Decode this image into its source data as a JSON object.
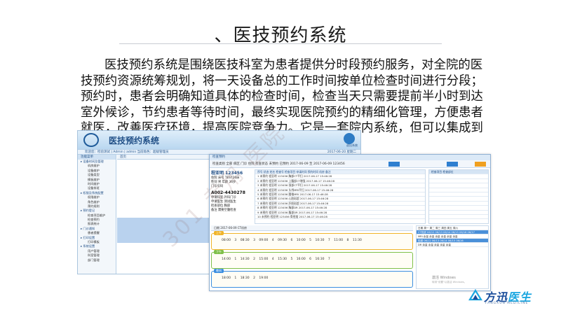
{
  "slide": {
    "title": "、医技预约系统",
    "paragraph": "医技预约系统是围绕医技科室为患者提供分时段预约服务，对全院的医技预约资源统筹规划，将一天设备总的工作时间按单位检查时间进行分段；预约时，患者会明确知道具体的检查时间，检查当天只需要提前半小时到达室外候诊，节约患者等待时间，最终实现医院预约的精细化管理，方便患者就医，改善医疗环境，提高医院竞争力。它是一套院内系统，但可以集成到互联网医院的医生工作站上。",
    "watermark": "301 专用 医院"
  },
  "app_window": {
    "title": "医技预约系统",
    "exit_label": "退出系统",
    "status_left": "欢迎您：检验测试 | Admin | admin   当前角色：超级管理员",
    "status_right": "2017-06-20 星期二",
    "side_header": "功能菜单",
    "tab_label": "首页",
    "menu": [
      {
        "label": "设备时间及管理",
        "type": "group"
      },
      {
        "label": "机房维护",
        "type": "child"
      },
      {
        "label": "设备维护",
        "type": "child"
      },
      {
        "label": "设备类型",
        "type": "child"
      },
      {
        "label": "模板维护",
        "type": "child"
      },
      {
        "label": "时间维护",
        "type": "child"
      },
      {
        "label": "设备排班",
        "type": "child"
      },
      {
        "label": "权限及系统配置",
        "type": "group"
      },
      {
        "label": "权限维护",
        "type": "child"
      },
      {
        "label": "角色维护",
        "type": "child"
      },
      {
        "label": "预约规则",
        "type": "child"
      },
      {
        "label": "预约登记",
        "type": "group"
      },
      {
        "label": "检查项目维护",
        "type": "child"
      },
      {
        "label": "检查预约",
        "type": "child"
      },
      {
        "label": "报表统计",
        "type": "child"
      },
      {
        "label": "门诊通知",
        "type": "group"
      },
      {
        "label": "患者提醒",
        "type": "child"
      },
      {
        "label": "打印设置",
        "type": "group"
      },
      {
        "label": "打印模板",
        "type": "child"
      },
      {
        "label": "系统设置",
        "type": "group"
      },
      {
        "label": "用户管理",
        "type": "child"
      },
      {
        "label": "科室管理",
        "type": "child"
      },
      {
        "label": "部门管理",
        "type": "child"
      }
    ]
  },
  "booking_window": {
    "title": "检查预约",
    "toolbar": "检查类别  全部  病区  门诊 住院  检查状态  未预约 已预约  2017-06-09  至  2017-06-09  123456",
    "patient": {
      "name": "程亚明 123456",
      "info_lines": [
        "住院  床号 TEST26床",
        "性别 男  年龄 36岁",
        "门诊号码"
      ],
      "code": "A002-4430278",
      "detail_lines": [
        "申请科室 外科门诊",
        "申请医生 测试医生",
        "检查部位 胸部",
        "备注 需要空腹检查"
      ]
    },
    "table_header": "序号  状态  姓名  检查号  检查项目  申请时间  预约时间  机房  备注",
    "table_rows": [
      "1  未预约  程亚明  123456  胸部CT平扫  2017-06-17 15:46:28",
      "2  未预约  程亚明  123456  上腹部CT增强  2017-06-17 15:46:28",
      "3  未预约  程亚明  123456  颈部CT平扫  2017-06-17 15:46:28",
      "4  未预约  程亚明  123456  头颅MRI平扫  2017-06-17 15:46:28",
      "5  未预约  程亚明  123456  腰椎MRI  2017-06-17 15:46:28",
      "6  未预约  程亚明  123456  心脏彩超  2017-06-17 15:46:28",
      "7  未预约  程亚明  123456  肝胆彩超  2017-06-17 15:46:28",
      "8  未预约  程亚明  123456  胸部DR  2017-06-17 15:46:28",
      "9  未预约  程亚明  123456  腹部DR  2017-06-17 15:46:28",
      "10  未预约  程亚明  123456  骨密度  2017-06-17 15:46:28"
    ],
    "right_header": "检查项目  检查部位",
    "right_rows": [
      "",
      "",
      "",
      "",
      "",
      "",
      "",
      "",
      "",
      ""
    ],
    "sched_bar": "日期 2017-06-09  CT机房",
    "slots": [
      {
        "tag": "上午",
        "color": "orange",
        "times": "08:00  3   08:30  3   09:00  4   09:30  6   10:00  5   10:30  7   11:00  8   11:30"
      },
      {
        "tag": "下午",
        "color": "green",
        "times": "14:00  1   14:30  2   15:00  4   15:30  5   16:00  6   16:30  7"
      },
      {
        "tag": "晚间",
        "color": "blue",
        "times": "18:00  1   18:30  2   19:00"
      }
    ],
    "grid_rows": [
      {
        "text": "日期   周一  周二  周三  周四  周五  周六",
        "blue": false
      },
      {
        "text": "CT机房  06/12  06/13  06/14  06/15  06/16  06/17",
        "blue": true
      },
      {
        "text": "MRI   余量  余量  余量  余量  余量  余量",
        "blue": false
      },
      {
        "text": "彩超   06/12  06/13  06/14  06/15  06/16",
        "blue": true
      },
      {
        "text": "DR    余量  余量  余量  余量  余量",
        "blue": false
      }
    ],
    "activation": "激活 Windows",
    "activation_sub": "转到\"设置\"以激活 Windows。"
  },
  "brand": {
    "name_main": "方迅",
    "name_accent": "医生",
    "subtitle": "FANGXUN MEDICINE"
  }
}
